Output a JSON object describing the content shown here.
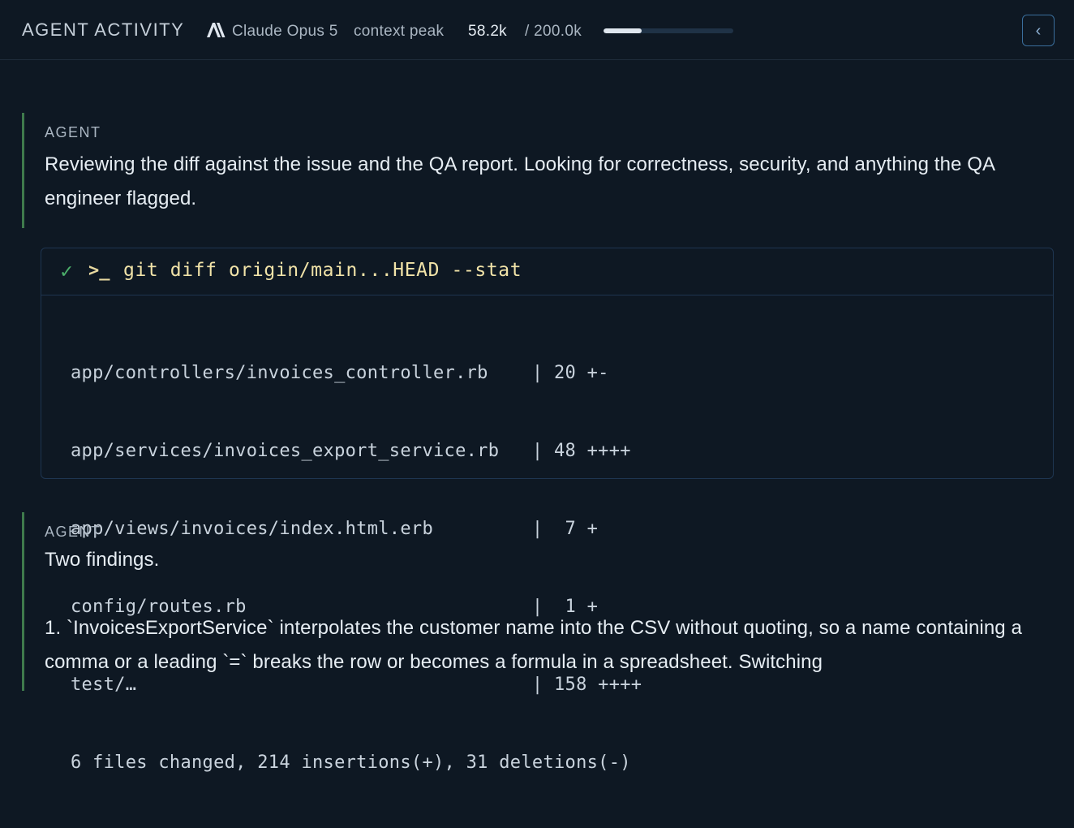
{
  "header": {
    "title": "AGENT ACTIVITY",
    "logo_icon": "anthropic-logo-icon",
    "model_name": "Claude Opus 5",
    "context_label": "context peak",
    "context_value": "58.2k",
    "context_max": "/ 200.0k",
    "context_fraction": 0.291,
    "collapse_glyph": "‹"
  },
  "messages": [
    {
      "role": "AGENT",
      "text": "Reviewing the diff against the issue and the QA report. Looking for correctness, security, and anything the QA engineer flagged."
    },
    {
      "role": "AGENT",
      "text": "Two findings.",
      "text2": "1. `InvoicesExportService` interpolates the customer name into the CSV without quoting, so a name containing a comma or a leading `=` breaks the row or becomes a formula in a spreadsheet. Switching"
    }
  ],
  "tool_call": {
    "status_icon": "check-icon",
    "status_glyph": "✓",
    "prompt_icon": "terminal-prompt-icon",
    "prompt_glyph": ">_",
    "command": "git diff origin/main...HEAD --stat",
    "output_lines": [
      "app/controllers/invoices_controller.rb    | 20 +-",
      "app/services/invoices_export_service.rb   | 48 ++++",
      "app/views/invoices/index.html.erb         |  7 +",
      "config/routes.rb                          |  1 +",
      "test/…                                    | 158 ++++",
      "6 files changed, 214 insertions(+), 31 deletions(-)"
    ]
  },
  "colors": {
    "background": "#0e1823",
    "accent_border": "#3f7a4c",
    "card_border": "#1e3550",
    "success": "#4caf6a",
    "command": "#f1e3a8"
  }
}
